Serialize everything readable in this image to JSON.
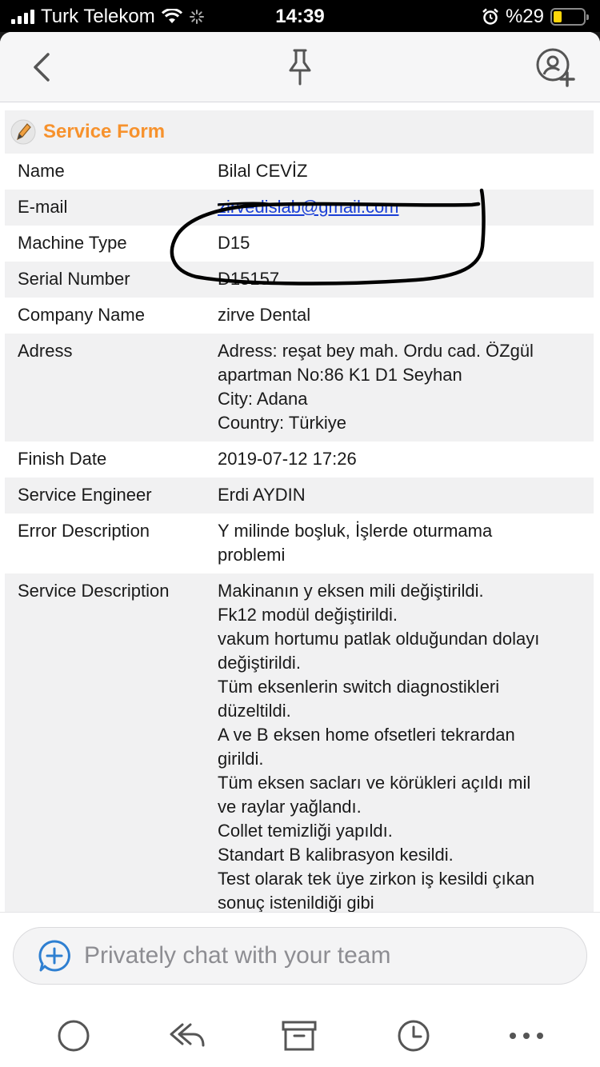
{
  "status_bar": {
    "carrier": "Turk Telekom",
    "time": "14:39",
    "battery_label": "%29",
    "battery_level": 0.29
  },
  "nav": {
    "icons": [
      "back-chevron-icon",
      "pin-icon",
      "add-user-icon"
    ]
  },
  "form": {
    "title": "Service Form",
    "rows": {
      "name": {
        "label": "Name",
        "value": "Bilal CEVİZ"
      },
      "email": {
        "label": "E-mail",
        "value": "zirvedislab@gmail.com"
      },
      "machine_type": {
        "label": "Machine Type",
        "value": "D15"
      },
      "serial_number": {
        "label": "Serial Number",
        "value": "D15157"
      },
      "company_name": {
        "label": "Company Name",
        "value": "zirve Dental"
      },
      "address": {
        "label": "Adress",
        "lines": [
          "Adress: reşat bey mah. Ordu cad. ÖZgül",
          "apartman No:86 K1 D1 Seyhan",
          "City: Adana",
          "Country: Türkiye"
        ]
      },
      "finish_date": {
        "label": "Finish Date",
        "value": "2019-07-12 17:26"
      },
      "service_engineer": {
        "label": "Service Engineer",
        "value": "Erdi AYDIN"
      },
      "error_description": {
        "label": "Error Description",
        "lines": [
          "Y milinde boşluk, İşlerde oturmama",
          "problemi"
        ]
      },
      "service_description": {
        "label": "Service Description",
        "lines": [
          "Makinanın y eksen mili değiştirildi.",
          "Fk12 modül değiştirildi.",
          "vakum hortumu patlak olduğundan dolayı",
          "değiştirildi.",
          "Tüm eksenlerin switch diagnostikleri",
          "düzeltildi.",
          "A ve B eksen home ofsetleri tekrardan",
          "girildi.",
          "Tüm eksen sacları ve körükleri açıldı mil",
          "ve raylar yağlandı.",
          "Collet temizliği yapıldı.",
          "Standart B kalibrasyon kesildi.",
          "Test olarak tek üye zirkon iş kesildi çıkan",
          "sonuç istenildiği gibi"
        ]
      }
    }
  },
  "chat": {
    "placeholder": "Privately chat with your team"
  },
  "tabbar": {
    "icons": [
      "circle-icon",
      "reply-all-icon",
      "archive-icon",
      "clock-icon",
      "more-icon"
    ]
  },
  "colors": {
    "accent_orange": "#f7922d",
    "link_blue": "#1a3fd6",
    "chat_icon_blue": "#2e7fd1"
  }
}
